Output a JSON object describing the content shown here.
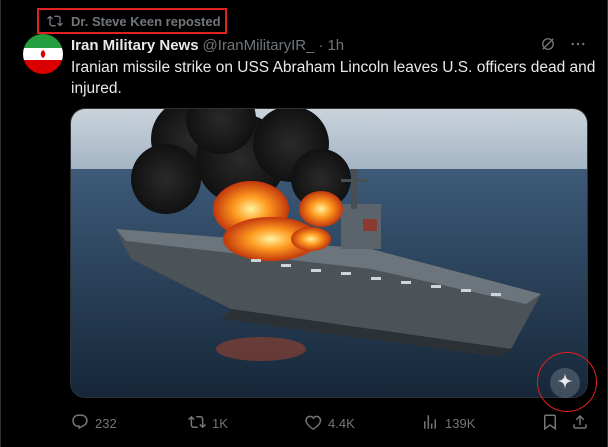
{
  "repost": {
    "label": "Dr. Steve Keen reposted"
  },
  "author": {
    "name": "Iran Military News",
    "handle": "@IranMilitaryIR_",
    "separator": "·",
    "time": "1h"
  },
  "tweet": {
    "text": "Iranian missile strike on USS Abraham Lincoln leaves U.S. officers dead and injured."
  },
  "media": {
    "description_icon": "grok-sparkle-icon"
  },
  "actions": {
    "replies": "232",
    "reposts": "1K",
    "likes": "4.4K",
    "views": "139K"
  },
  "colors": {
    "accent_red": "#e0211f",
    "muted": "#71767b",
    "text": "#e7e9ea",
    "background": "#000000"
  }
}
